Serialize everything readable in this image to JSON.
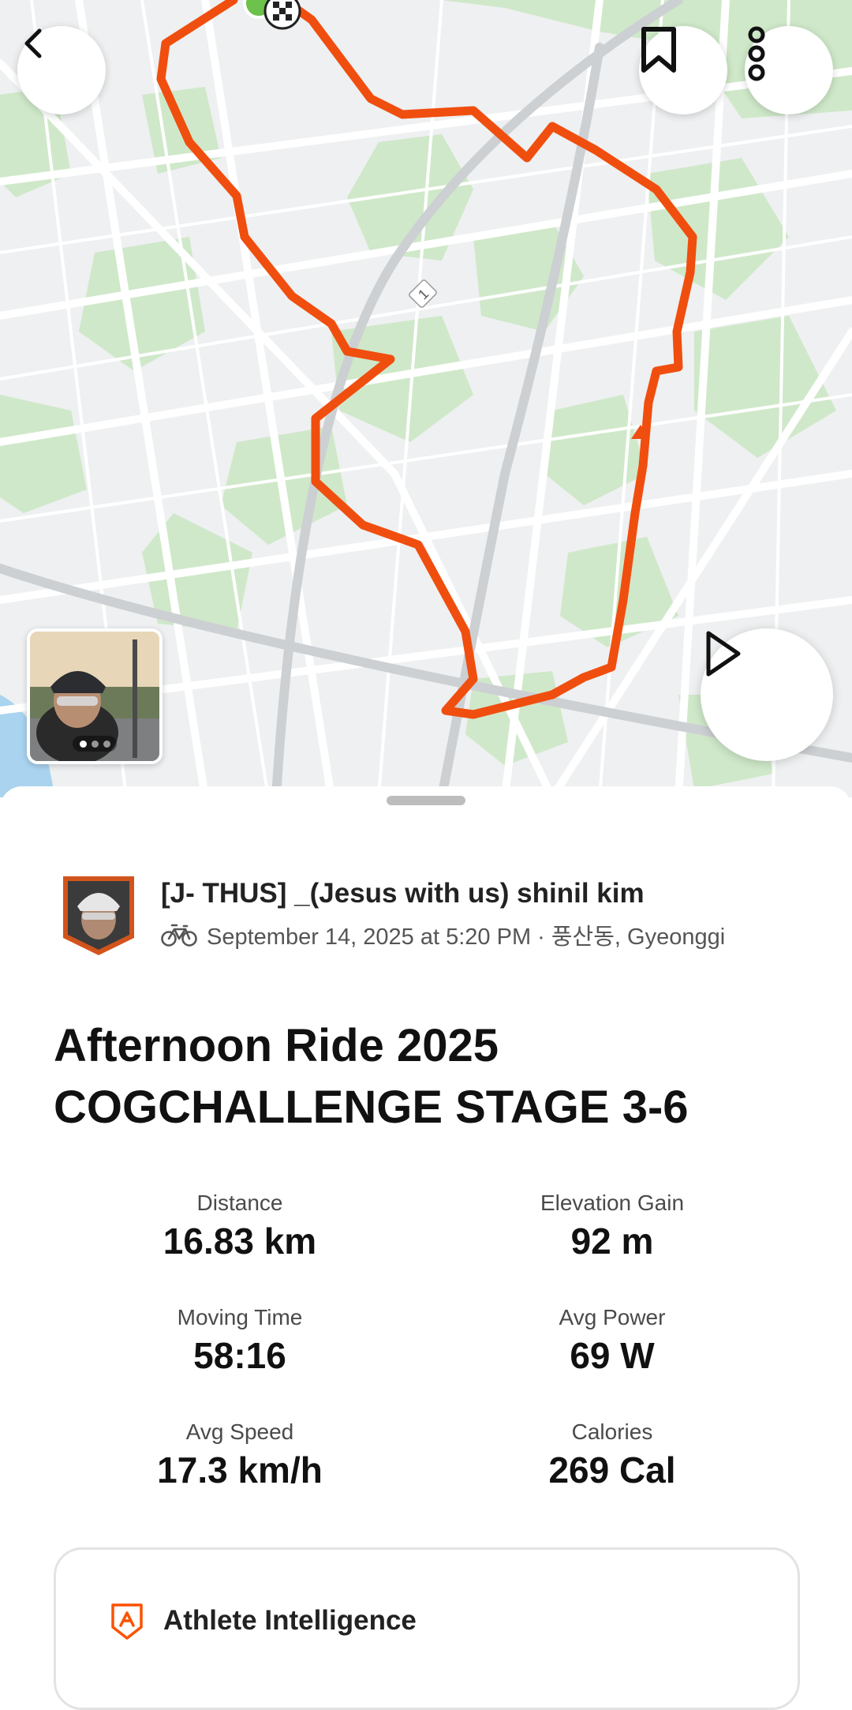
{
  "header": {
    "back_icon": "chevron-left-icon",
    "bookmark_icon": "bookmark-icon",
    "more_icon": "more-vertical-icon",
    "road_label": "1"
  },
  "colors": {
    "route": "#f04e0f",
    "accent": "#fc5200",
    "start_marker": "#6cc24a",
    "map_bg": "#eef0f1",
    "park": "#cfe8c9"
  },
  "media": {
    "play_icon": "play-icon",
    "photo_count": 3,
    "active_photo": 1
  },
  "athlete": {
    "name": "[J- THUS] _(Jesus with us) shinil kim",
    "activity_icon": "bicycle-icon",
    "datetime_location": "September 14, 2025 at 5:20 PM · 풍산동, Gyeonggi"
  },
  "activity": {
    "title": "Afternoon Ride 2025 COGCHALLENGE STAGE 3-6"
  },
  "stats": [
    {
      "label": "Distance",
      "value": "16.83 km"
    },
    {
      "label": "Elevation Gain",
      "value": "92 m"
    },
    {
      "label": "Moving Time",
      "value": "58:16"
    },
    {
      "label": "Avg Power",
      "value": "69 W"
    },
    {
      "label": "Avg Speed",
      "value": "17.3 km/h"
    },
    {
      "label": "Calories",
      "value": "269 Cal"
    }
  ],
  "athlete_intelligence": {
    "label": "Athlete Intelligence",
    "icon": "athlete-intelligence-icon"
  }
}
